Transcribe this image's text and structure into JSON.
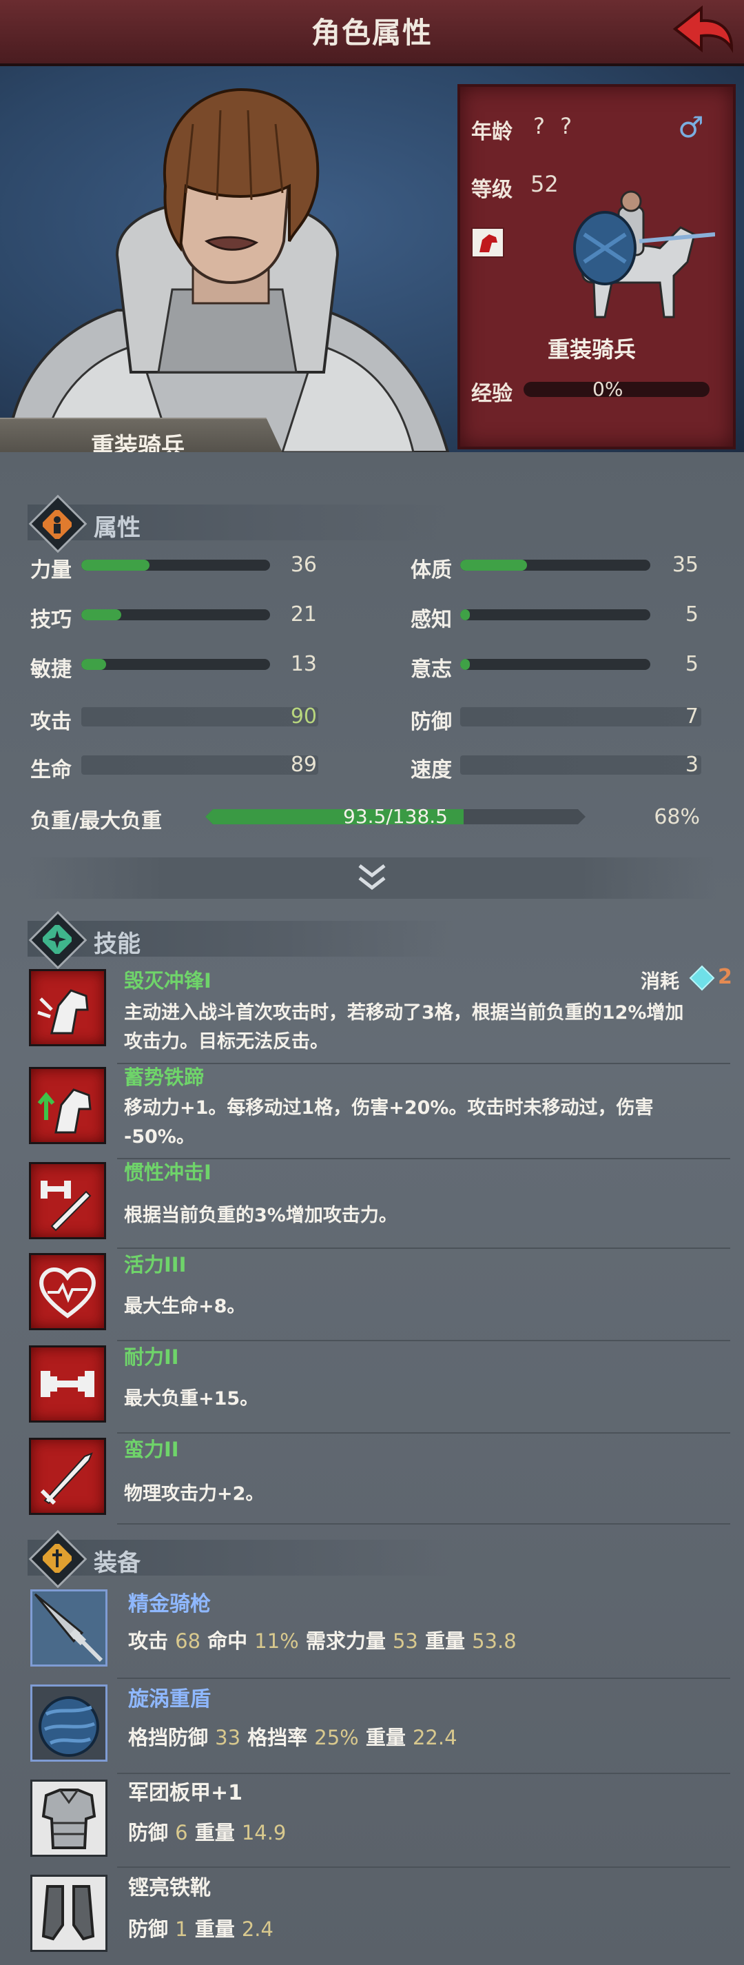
{
  "header": {
    "title": "角色属性"
  },
  "character": {
    "name": "重装骑兵",
    "age_label": "年龄",
    "age_value": "? ?",
    "level_label": "等级",
    "level_value": "52",
    "unit_name": "重装骑兵",
    "exp_label": "经验",
    "exp_value": "0%",
    "exp_fraction": 0
  },
  "attributes": {
    "section_title": "属性",
    "left": [
      {
        "label": "力量",
        "value": "36",
        "fill": 0.36
      },
      {
        "label": "技巧",
        "value": "21",
        "fill": 0.21
      },
      {
        "label": "敏捷",
        "value": "13",
        "fill": 0.13
      }
    ],
    "right": [
      {
        "label": "体质",
        "value": "35",
        "fill": 0.35
      },
      {
        "label": "感知",
        "value": "5",
        "fill": 0.05
      },
      {
        "label": "意志",
        "value": "5",
        "fill": 0.05
      }
    ],
    "derived_left": [
      {
        "label": "攻击",
        "value": "90"
      },
      {
        "label": "生命",
        "value": "89"
      }
    ],
    "derived_right": [
      {
        "label": "防御",
        "value": "7"
      },
      {
        "label": "速度",
        "value": "3"
      }
    ],
    "load_label": "负重/最大负重",
    "load_value": "93.5/138.5",
    "load_percent": "68%",
    "load_fraction": 0.68
  },
  "skills": {
    "section_title": "技能",
    "cost_label": "消耗",
    "cost_value": "2",
    "items": [
      {
        "name": "毁灭冲锋I",
        "desc1": "主动进入战斗首次攻击时，若移动了3格，根据当前负重的12%增加",
        "desc2": "攻击力。目标无法反击。"
      },
      {
        "name": "蓄势铁蹄",
        "desc1": "移动力+1。每移动过1格，伤害+20%。攻击时未移动过，伤害",
        "desc2": "-50%。"
      },
      {
        "name": "惯性冲击I",
        "desc1": "根据当前负重的3%增加攻击力。",
        "desc2": ""
      },
      {
        "name": "活力III",
        "desc1": "最大生命+8。",
        "desc2": ""
      },
      {
        "name": "耐力II",
        "desc1": "最大负重+15。",
        "desc2": ""
      },
      {
        "name": "蛮力II",
        "desc1": "物理攻击力+2。",
        "desc2": ""
      }
    ]
  },
  "equipment": {
    "section_title": "装备",
    "items": [
      {
        "name": "精金骑枪",
        "color": "#8fb8ff",
        "l1": "攻击",
        "v1": "68",
        "l2": "命中",
        "v2": "11%",
        "l3": "需求力量",
        "v3": "53",
        "l4": "重量",
        "v4": "53.8"
      },
      {
        "name": "旋涡重盾",
        "color": "#8fb8ff",
        "l1": "格挡防御",
        "v1": "33",
        "l2": "格挡率",
        "v2": "25%",
        "l3": "重量",
        "v3": "22.4",
        "l4": "",
        "v4": ""
      },
      {
        "name": "军团板甲+1",
        "color": "#f4f1ea",
        "l1": "防御",
        "v1": "6",
        "l2": "重量",
        "v2": "14.9",
        "l3": "",
        "v3": "",
        "l4": "",
        "v4": ""
      },
      {
        "name": "铿亮铁靴",
        "color": "#f4f1ea",
        "l1": "防御",
        "v1": "1",
        "l2": "重量",
        "v2": "2.4",
        "l3": "",
        "v3": "",
        "l4": "",
        "v4": ""
      }
    ]
  },
  "colors": {
    "accent_red": "#6e2228",
    "bar_green": "#3fa146",
    "skill_green": "#6fd46a",
    "rare_blue": "#8fb8ff",
    "gem_cyan": "#6fe0e8",
    "cost_orange": "#e58a52"
  },
  "icons": [
    "back-arrow-icon",
    "male-icon",
    "horse-head-icon",
    "attribute-icon",
    "skill-icon",
    "equipment-icon",
    "expand-chevron-icon",
    "gem-icon"
  ]
}
